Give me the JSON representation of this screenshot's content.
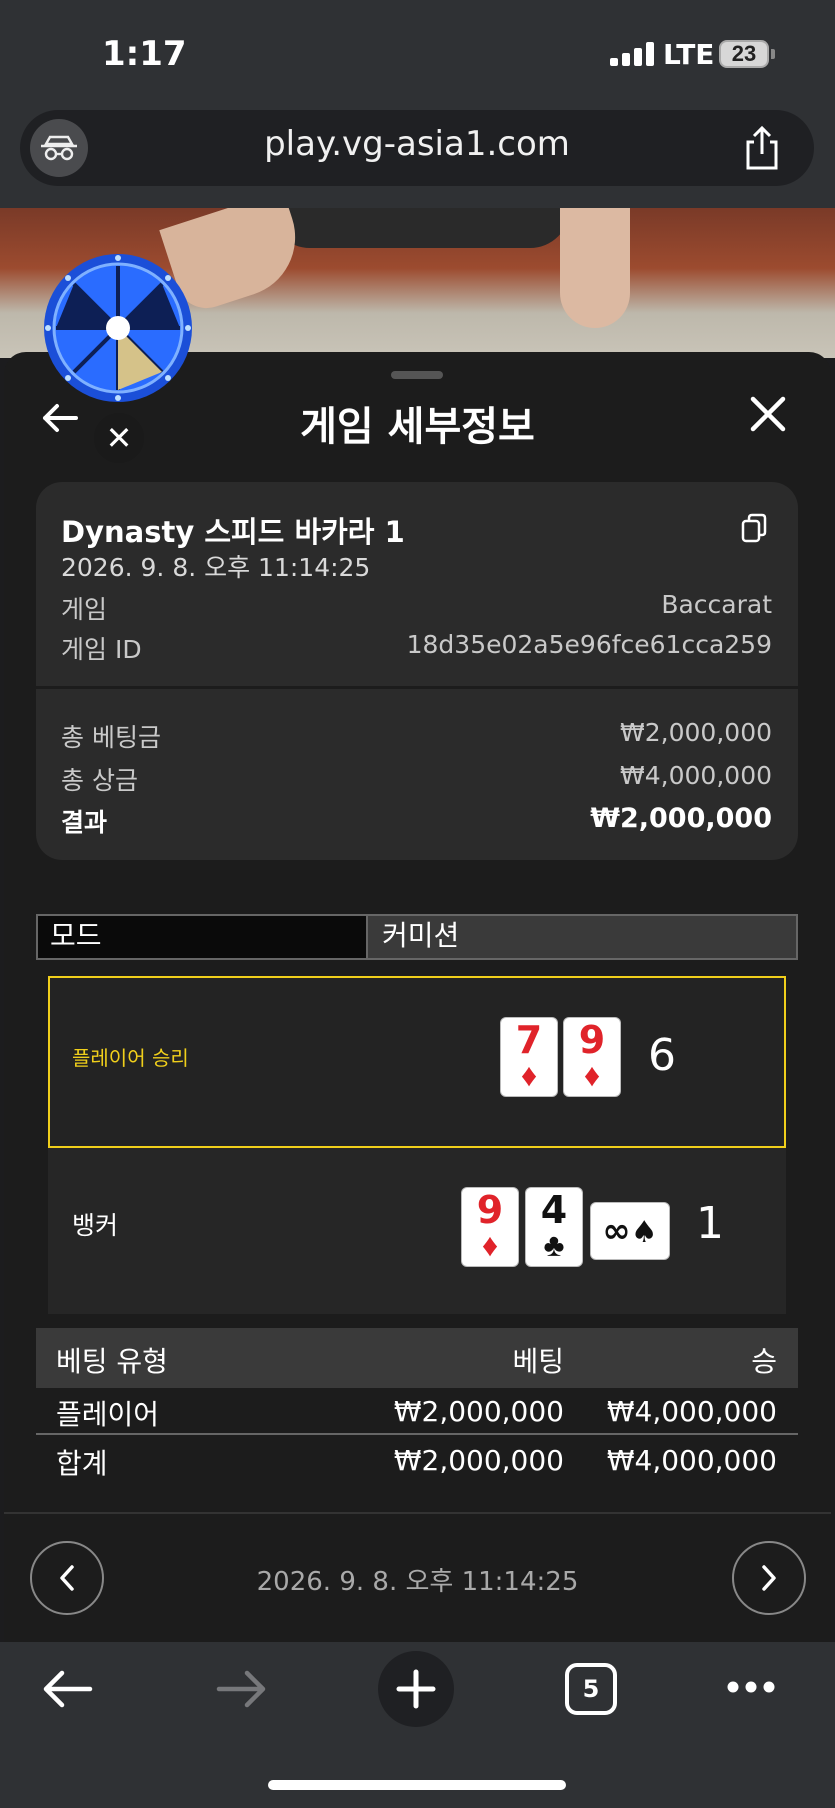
{
  "status_bar": {
    "time": "1:17",
    "network": "LTE",
    "battery": "23"
  },
  "browser": {
    "url": "play.vg-asia1.com",
    "tab_count": "5"
  },
  "header": {
    "title": "게임 세부정보"
  },
  "summary": {
    "game_name": "Dynasty 스피드 바카라 1",
    "datetime": "2026. 9. 8. 오후 11:14:25",
    "game_label": "게임",
    "game_value": "Baccarat",
    "game_id_label": "게임 ID",
    "game_id_value": "18d35e02a5e96fce61cca259",
    "total_bet_label": "총 베팅금",
    "total_bet_value": "₩2,000,000",
    "total_prize_label": "총 상금",
    "total_prize_value": "₩4,000,000",
    "result_label": "결과",
    "result_value": "₩2,000,000"
  },
  "mode_bar": {
    "mode_label": "모드",
    "commission_label": "커미션"
  },
  "hands": {
    "player": {
      "label": "플레이어 승리",
      "score": "6",
      "cards": [
        {
          "rank": "7",
          "suit": "♦"
        },
        {
          "rank": "9",
          "suit": "♦"
        }
      ]
    },
    "banker": {
      "label": "뱅커",
      "score": "1",
      "cards": [
        {
          "rank": "9",
          "suit": "♦"
        },
        {
          "rank": "4",
          "suit": "♣"
        },
        {
          "rank": "∞",
          "suit": "♠"
        }
      ]
    }
  },
  "bet_table": {
    "headers": {
      "type": "베팅 유형",
      "bet": "베팅",
      "win": "승"
    },
    "rows": [
      {
        "type": "플레이어",
        "bet": "₩2,000,000",
        "win": "₩4,000,000"
      }
    ],
    "total": {
      "type": "합계",
      "bet": "₩2,000,000",
      "win": "₩4,000,000"
    }
  },
  "pager": {
    "datetime": "2026. 9. 8. 오후 11:14:25"
  },
  "colors": {
    "accent": "#f0cf1b",
    "red_suit": "#e0232a",
    "panel": "#1c1c1c",
    "card_bg": "#2b2b2b"
  },
  "icons": [
    "incognito-icon",
    "share-icon",
    "back-arrow-icon",
    "close-icon",
    "copy-icon",
    "chevron-left-icon",
    "chevron-right-icon",
    "nav-back-icon",
    "nav-forward-icon",
    "plus-icon",
    "tabs-icon",
    "more-icon",
    "prize-wheel-icon"
  ]
}
